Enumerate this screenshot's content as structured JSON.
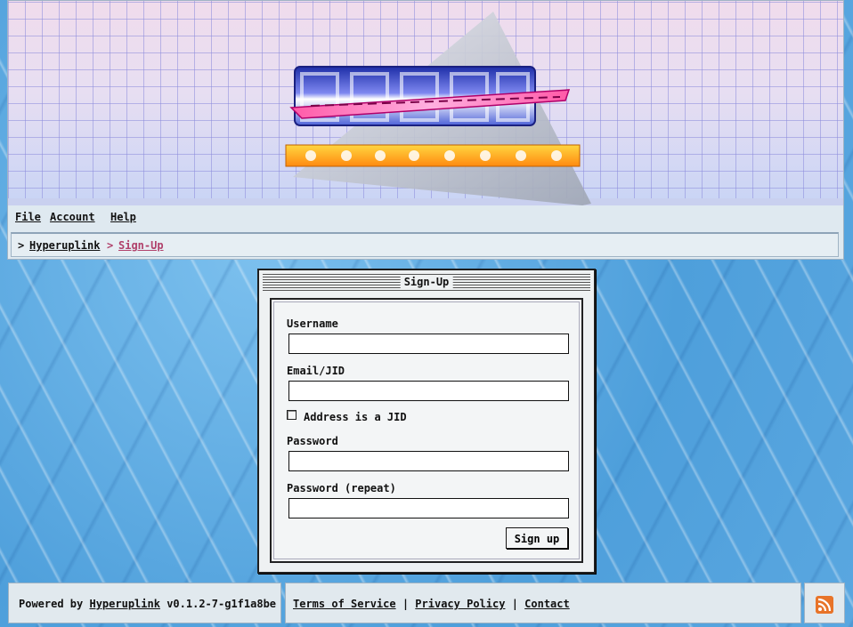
{
  "menu": {
    "items": [
      "File",
      "Account",
      "Help"
    ]
  },
  "breadcrumb": {
    "separator": ">",
    "root": "Hyperuplink",
    "current": "Sign-Up"
  },
  "dialog": {
    "title": "Sign-Up",
    "username_label": "Username",
    "email_label": "Email/JID",
    "jid_checkbox_label": "Address is a JID",
    "jid_checked": false,
    "password_label": "Password",
    "password_repeat_label": "Password (repeat)",
    "submit_label": "Sign up"
  },
  "footer": {
    "powered_prefix": "Powered by",
    "powered_link": "Hyperuplink",
    "version": "v0.1.2-7-g1f1a8be",
    "terms": "Terms of Service",
    "privacy": "Privacy Policy",
    "contact": "Contact",
    "separator": "|"
  },
  "icons": {
    "feed": "rss-icon"
  },
  "colors": {
    "current_crumb": "#b0406a",
    "rss": "#e8742a"
  }
}
